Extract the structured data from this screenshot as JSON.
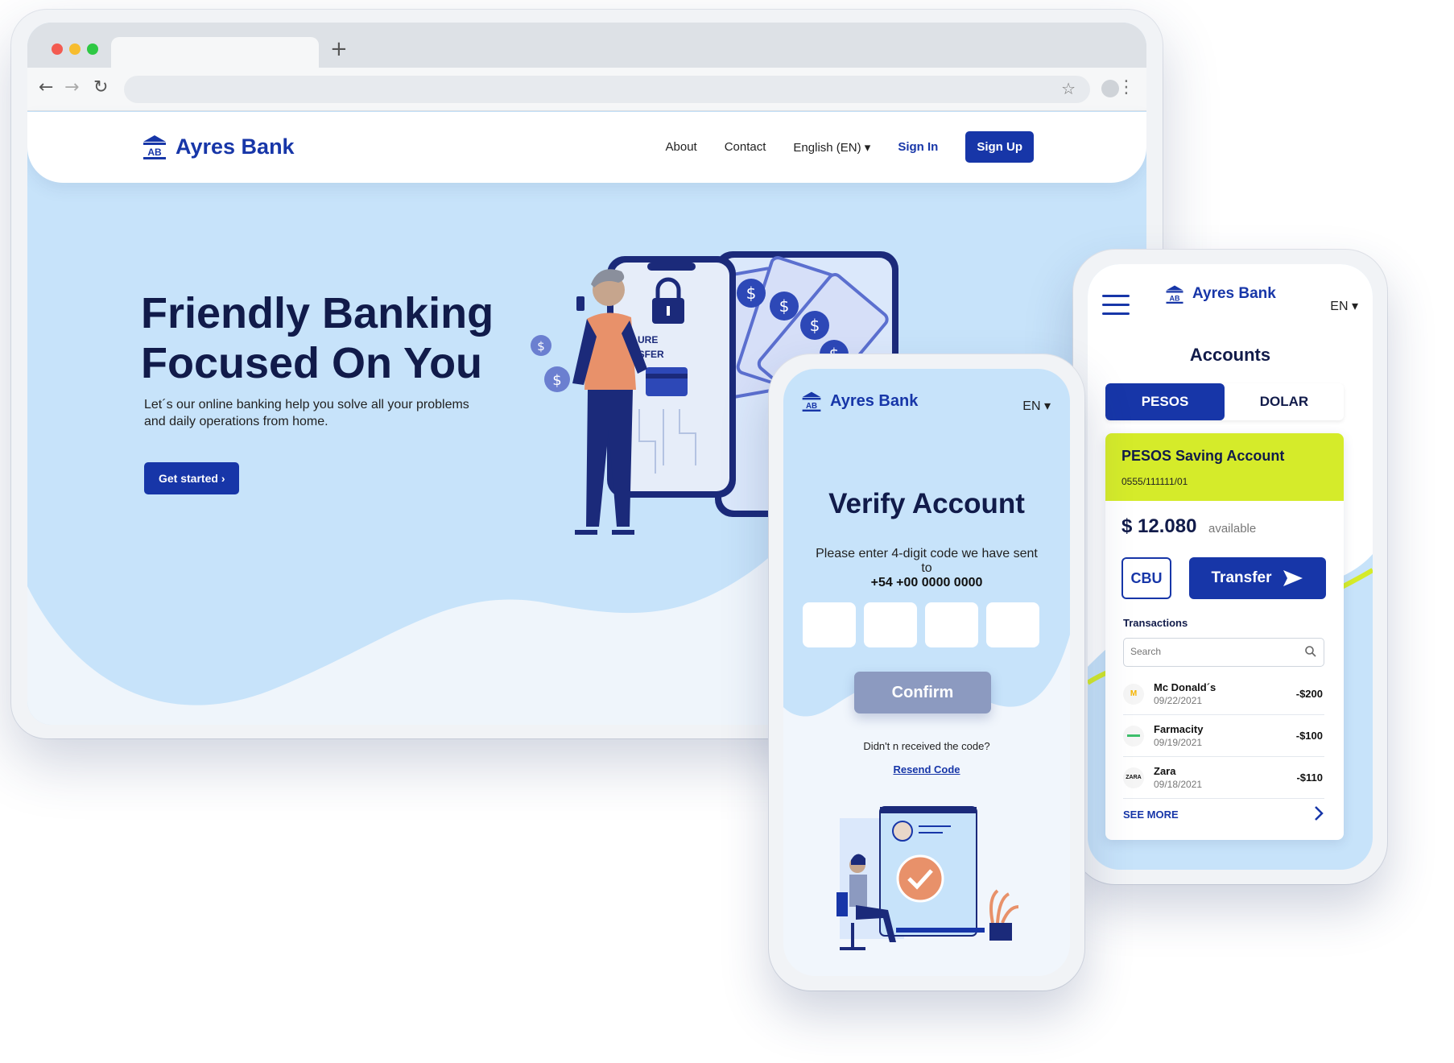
{
  "brand": {
    "name": "Ayres Bank",
    "logo_text": "AB",
    "primary_color": "#1736a8",
    "accent_color": "#d5eb2a",
    "background_color": "#c7e3fa"
  },
  "browser": {
    "new_tab_icon": "+",
    "nav_icons": [
      "back-arrow-icon",
      "forward-arrow-icon",
      "reload-icon",
      "star-icon",
      "kebab-menu-icon"
    ]
  },
  "site": {
    "nav": {
      "about": "About",
      "contact": "Contact",
      "language": "English (EN)",
      "signin": "Sign In",
      "signup": "Sign Up"
    },
    "hero": {
      "title_line1": "Friendly Banking",
      "title_line2": "Focused On You",
      "subtitle": "Let´s our online banking help you solve all your problems and daily operations from home.",
      "cta": "Get started"
    },
    "illustration": {
      "lock_text_line1": "URE",
      "lock_text_line2": "NSFER"
    }
  },
  "verify": {
    "language": "EN",
    "title": "Verify Account",
    "message": "Please enter 4-digit code we have sent to",
    "phone_number": "+54 +00 0000 0000",
    "code_boxes": [
      "",
      "",
      "",
      ""
    ],
    "confirm_label": "Confirm",
    "resend_question": "Didn't n received the code?",
    "resend_link": "Resend Code"
  },
  "accounts": {
    "language": "EN",
    "title": "Accounts",
    "currencies": [
      "PESOS",
      "DOLAR"
    ],
    "selected_currency": "PESOS",
    "account": {
      "name": "PESOS Saving Account",
      "number": "0555/111111/01",
      "balance": "$ 12.080",
      "balance_label": "available"
    },
    "actions": {
      "cbu": "CBU",
      "transfer": "Transfer"
    },
    "transactions_label": "Transactions",
    "search_placeholder": "Search",
    "transactions": [
      {
        "name": "Mc Donald´s",
        "date": "09/22/2021",
        "amount": "-$200",
        "logo": "M"
      },
      {
        "name": "Farmacity",
        "date": "09/19/2021",
        "amount": "-$100",
        "logo": ""
      },
      {
        "name": "Zara",
        "date": "09/18/2021",
        "amount": "-$110",
        "logo": "ZARA"
      }
    ],
    "see_more": "SEE MORE"
  }
}
